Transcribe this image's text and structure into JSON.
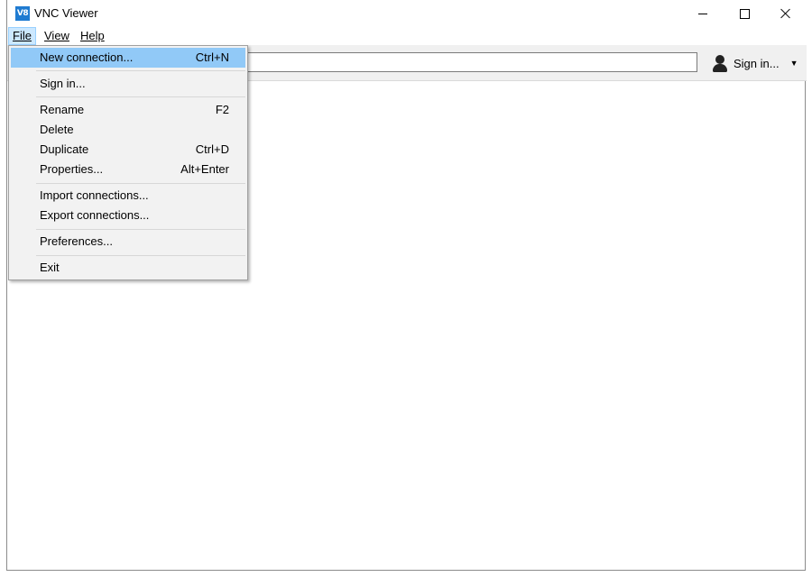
{
  "window": {
    "app_icon": "V8",
    "title": "VNC Viewer"
  },
  "menubar": {
    "file": "File",
    "view": "View",
    "help": "Help"
  },
  "toolbar": {
    "search_value": "",
    "signin_label": "Sign in..."
  },
  "file_menu": {
    "items": [
      {
        "label": "New connection...",
        "shortcut": "Ctrl+N"
      },
      {
        "label": "Sign in...",
        "shortcut": ""
      },
      {
        "label": "Rename",
        "shortcut": "F2"
      },
      {
        "label": "Delete",
        "shortcut": ""
      },
      {
        "label": "Duplicate",
        "shortcut": "Ctrl+D"
      },
      {
        "label": "Properties...",
        "shortcut": "Alt+Enter"
      },
      {
        "label": "Import connections...",
        "shortcut": ""
      },
      {
        "label": "Export connections...",
        "shortcut": ""
      },
      {
        "label": "Preferences...",
        "shortcut": ""
      },
      {
        "label": "Exit",
        "shortcut": ""
      }
    ]
  },
  "colors": {
    "highlight": "#91c9f7",
    "menu_active": "#cce8ff",
    "app_icon": "#1f7bd1"
  }
}
